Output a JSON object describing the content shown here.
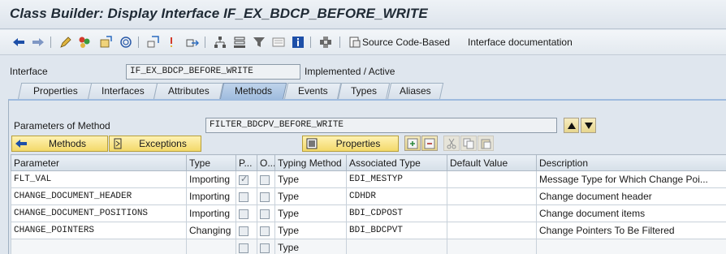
{
  "window": {
    "title": "Class Builder: Display Interface IF_EX_BDCP_BEFORE_WRITE"
  },
  "toolbar": {
    "icons": [
      "back-arrow-icon",
      "forward-arrow-icon",
      "edit-pencil-icon",
      "check-objects-icon",
      "activate-icon",
      "where-used-icon",
      "info-marker-icon",
      "navigate-icon",
      "hierarchy-icon",
      "stack-icon",
      "filter-icon",
      "layout-icon",
      "info-icon",
      "plug-icon",
      "source-code-icon"
    ],
    "source_code_label": "Source Code-Based",
    "interface_doc_label": "Interface documentation"
  },
  "header": {
    "interface_label": "Interface",
    "interface_value": "IF_EX_BDCP_BEFORE_WRITE",
    "status": "Implemented / Active"
  },
  "tabs": [
    {
      "label": "Properties",
      "active": false
    },
    {
      "label": "Interfaces",
      "active": false
    },
    {
      "label": "Attributes",
      "active": false
    },
    {
      "label": "Methods",
      "active": true
    },
    {
      "label": "Events",
      "active": false
    },
    {
      "label": "Types",
      "active": false
    },
    {
      "label": "Aliases",
      "active": false
    }
  ],
  "method": {
    "params_label": "Parameters of Method",
    "method_name": "FILTER_BDCPV_BEFORE_WRITE"
  },
  "buttons": {
    "methods": "Methods",
    "exceptions": "Exceptions",
    "properties": "Properties"
  },
  "table": {
    "columns": [
      "Parameter",
      "Type",
      "P...",
      "O...",
      "Typing Method",
      "Associated Type",
      "Default Value",
      "Description"
    ],
    "rows": [
      {
        "parameter": "FLT_VAL",
        "type": "Importing",
        "pass_value": true,
        "optional": false,
        "typing": "Type",
        "assoc": "EDI_MESTYP",
        "default": "",
        "description": "Message Type  for Which Change Poi..."
      },
      {
        "parameter": "CHANGE_DOCUMENT_HEADER",
        "type": "Importing",
        "pass_value": false,
        "optional": false,
        "typing": "Type",
        "assoc": "CDHDR",
        "default": "",
        "description": "Change document header"
      },
      {
        "parameter": "CHANGE_DOCUMENT_POSITIONS",
        "type": "Importing",
        "pass_value": false,
        "optional": false,
        "typing": "Type",
        "assoc": "BDI_CDPOST",
        "default": "",
        "description": "Change document items"
      },
      {
        "parameter": "CHANGE_POINTERS",
        "type": "Changing",
        "pass_value": false,
        "optional": false,
        "typing": "Type",
        "assoc": "BDI_BDCPVT",
        "default": "",
        "description": "Change Pointers To Be Filtered"
      },
      {
        "parameter": "",
        "type": "",
        "pass_value": false,
        "optional": false,
        "typing": "Type",
        "assoc": "",
        "default": "",
        "description": ""
      }
    ]
  },
  "colors": {
    "accent_tab": "#9ebbde",
    "button_yellow": "#f3d96a",
    "arrow_blue": "#1d4fa8"
  }
}
